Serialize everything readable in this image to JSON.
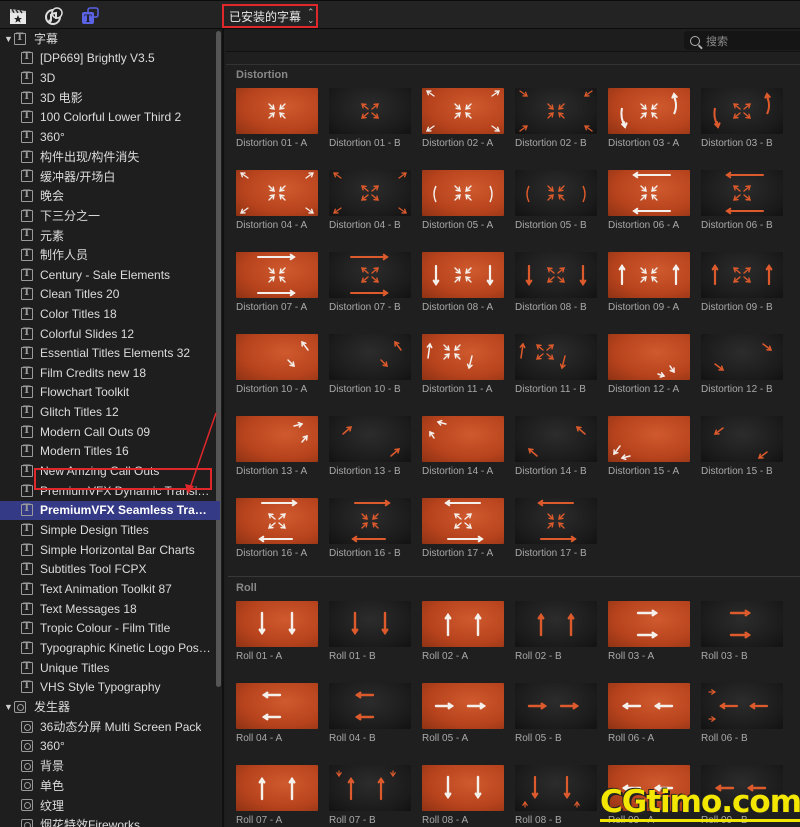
{
  "topbar": {
    "icons": [
      "photos-icon",
      "music-icon",
      "titles-icon"
    ],
    "dropdown_label": "已安装的字幕",
    "dropdown_chevron": "⌃⌄"
  },
  "search": {
    "placeholder": "搜索"
  },
  "sidebar": {
    "groups": [
      {
        "label": "字幕",
        "icon": "title-icon",
        "expanded": true,
        "items": [
          "[DP669] Brightly V3.5",
          "3D",
          "3D 电影",
          "100 Colorful Lower Third 2",
          "360°",
          "构件出现/构件消失",
          "缓冲器/开场白",
          "晚会",
          "下三分之一",
          "元素",
          "制作人员",
          "Century - Sale Elements",
          "Clean Titles 20",
          "Color Titles 18",
          "Colorful Slides 12",
          "Essential Titles Elements 32",
          "Film Credits new 18",
          "Flowchart Toolkit",
          "Glitch Titles 12",
          "Modern Call Outs 09",
          "Modern Titles 16",
          "New Amzing Call Outs",
          "PremiumVFX Dynamic Transiti...",
          "PremiumVFX Seamless Transiti...",
          "Simple Design Titles",
          "Simple Horizontal Bar Charts",
          "Subtitles Tool FCPX",
          "Text Animation Toolkit 87",
          "Text Messages 18",
          "Tropic Colour - Film Title",
          "Typographic Kinetic Logo Post...",
          "Unique Titles",
          "VHS Style Typography"
        ]
      },
      {
        "label": "发生器",
        "icon": "generator-icon",
        "expanded": true,
        "items": [
          "36动态分屏 Multi Screen Pack",
          "360°",
          "背景",
          "单色",
          "纹理",
          "烟花特效Fireworks"
        ]
      }
    ],
    "selected_item": "PremiumVFX Seamless Transiti..."
  },
  "sections": [
    {
      "title": "Distortion",
      "items": [
        {
          "label": "Distortion 01 - A",
          "variant": "A",
          "glyph": "in"
        },
        {
          "label": "Distortion 01 - B",
          "variant": "B",
          "glyph": "out"
        },
        {
          "label": "Distortion 02 - A",
          "variant": "A",
          "glyph": "in-corners-out"
        },
        {
          "label": "Distortion 02 - B",
          "variant": "B",
          "glyph": "in-corners-in"
        },
        {
          "label": "Distortion 03 - A",
          "variant": "A",
          "glyph": "in-curves"
        },
        {
          "label": "Distortion 03 - B",
          "variant": "B",
          "glyph": "out-curves"
        },
        {
          "label": "Distortion 04 - A",
          "variant": "A",
          "glyph": "in-corners-out"
        },
        {
          "label": "Distortion 04 - B",
          "variant": "B",
          "glyph": "out-corners-out"
        },
        {
          "label": "Distortion 05 - A",
          "variant": "A",
          "glyph": "in-swirl"
        },
        {
          "label": "Distortion 05 - B",
          "variant": "B",
          "glyph": "in-swirl"
        },
        {
          "label": "Distortion 06 - A",
          "variant": "A",
          "glyph": "in-left-bars"
        },
        {
          "label": "Distortion 06 - B",
          "variant": "B",
          "glyph": "out-left-bars"
        },
        {
          "label": "Distortion 07 - A",
          "variant": "A",
          "glyph": "in-right-bars"
        },
        {
          "label": "Distortion 07 - B",
          "variant": "B",
          "glyph": "out-right-bars"
        },
        {
          "label": "Distortion 08 - A",
          "variant": "A",
          "glyph": "in-down"
        },
        {
          "label": "Distortion 08 - B",
          "variant": "B",
          "glyph": "out-down"
        },
        {
          "label": "Distortion 09 - A",
          "variant": "A",
          "glyph": "in-up"
        },
        {
          "label": "Distortion 09 - B",
          "variant": "B",
          "glyph": "out-up"
        },
        {
          "label": "Distortion 10 - A",
          "variant": "A",
          "glyph": "diag-pair"
        },
        {
          "label": "Distortion 10 - B",
          "variant": "B",
          "glyph": "diag-pair"
        },
        {
          "label": "Distortion 11 - A",
          "variant": "A",
          "glyph": "in-small-curves"
        },
        {
          "label": "Distortion 11 - B",
          "variant": "B",
          "glyph": "out-small-curves"
        },
        {
          "label": "Distortion 12 - A",
          "variant": "A",
          "glyph": "bottom-right"
        },
        {
          "label": "Distortion 12 - B",
          "variant": "B",
          "glyph": "down-right-pair"
        },
        {
          "label": "Distortion 13 - A",
          "variant": "A",
          "glyph": "top-right"
        },
        {
          "label": "Distortion 13 - B",
          "variant": "B",
          "glyph": "up-right-pair"
        },
        {
          "label": "Distortion 14 - A",
          "variant": "A",
          "glyph": "top-left"
        },
        {
          "label": "Distortion 14 - B",
          "variant": "B",
          "glyph": "up-left-pair"
        },
        {
          "label": "Distortion 15 - A",
          "variant": "A",
          "glyph": "bottom-left"
        },
        {
          "label": "Distortion 15 - B",
          "variant": "B",
          "glyph": "down-left-pair"
        },
        {
          "label": "Distortion 16 - A",
          "variant": "A",
          "glyph": "out-bars-rl"
        },
        {
          "label": "Distortion 16 - B",
          "variant": "B",
          "glyph": "in-bars-rl"
        },
        {
          "label": "Distortion 17 - A",
          "variant": "A",
          "glyph": "out-bars-lr"
        },
        {
          "label": "Distortion 17 - B",
          "variant": "B",
          "glyph": "in-bars-lr"
        }
      ]
    },
    {
      "title": "Roll",
      "items": [
        {
          "label": "Roll 01 - A",
          "variant": "A",
          "glyph": "down2"
        },
        {
          "label": "Roll 01 - B",
          "variant": "B",
          "glyph": "down2"
        },
        {
          "label": "Roll 02 - A",
          "variant": "A",
          "glyph": "up2"
        },
        {
          "label": "Roll 02 - B",
          "variant": "B",
          "glyph": "up2"
        },
        {
          "label": "Roll 03 - A",
          "variant": "A",
          "glyph": "right-stack"
        },
        {
          "label": "Roll 03 - B",
          "variant": "B",
          "glyph": "right-stack"
        },
        {
          "label": "Roll 04 - A",
          "variant": "A",
          "glyph": "left-stack"
        },
        {
          "label": "Roll 04 - B",
          "variant": "B",
          "glyph": "left-stack"
        },
        {
          "label": "Roll 05 - A",
          "variant": "A",
          "glyph": "right2"
        },
        {
          "label": "Roll 05 - B",
          "variant": "B",
          "glyph": "right2"
        },
        {
          "label": "Roll 06 - A",
          "variant": "A",
          "glyph": "left2"
        },
        {
          "label": "Roll 06 - B",
          "variant": "B",
          "glyph": "left2-small"
        },
        {
          "label": "Roll 07 - A",
          "variant": "A",
          "glyph": "up2"
        },
        {
          "label": "Roll 07 - B",
          "variant": "B",
          "glyph": "up2-small"
        },
        {
          "label": "Roll 08 - A",
          "variant": "A",
          "glyph": "down2"
        },
        {
          "label": "Roll 08 - B",
          "variant": "B",
          "glyph": "down2-small"
        },
        {
          "label": "Roll 09 - A",
          "variant": "A",
          "glyph": "left2"
        },
        {
          "label": "Roll 09 - B",
          "variant": "B",
          "glyph": "left2"
        }
      ]
    }
  ],
  "colors": {
    "accent_orange": "#c2461e",
    "highlight_red": "#e0272c",
    "selection_blue": "#353a86"
  },
  "watermark": "CGtimo.com"
}
